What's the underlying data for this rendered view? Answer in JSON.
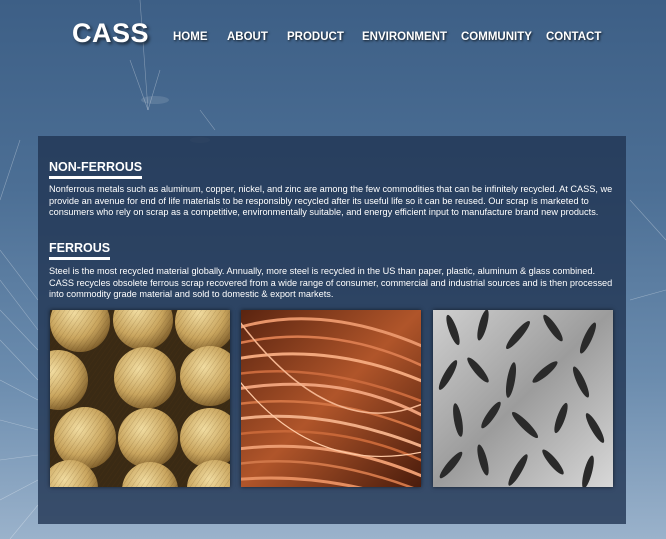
{
  "brand": {
    "logo": "CASS"
  },
  "nav": {
    "items": [
      {
        "label": "HOME"
      },
      {
        "label": "ABOUT"
      },
      {
        "label": "PRODUCT"
      },
      {
        "label": "ENVIRONMENT"
      },
      {
        "label": "COMMUNITY"
      },
      {
        "label": "CONTACT"
      }
    ]
  },
  "content": {
    "nonferrous": {
      "title": "NON-FERROUS",
      "text": "Nonferrous metals such as aluminum, copper, nickel, and zinc are among the few commodities that can be infinitely recycled. At CASS, we provide an avenue for end of life materials to be responsibly recycled after its useful life so it can be reused. Our scrap is marketed to consumers who rely on scrap as a competitive, environmentally suitable, and energy efficient input to manufacture brand new products."
    },
    "ferrous": {
      "title": "FERROUS",
      "text": "Steel is the most recycled material globally. Annually, more steel is recycled in the US than paper, plastic, aluminum & glass combined. CASS recycles obsolete ferrous scrap recovered from a wide range of consumer, commercial and industrial sources and is then processed into commodity grade material and sold to domestic & export markets."
    }
  },
  "photos": [
    {
      "icon": "brass-rods-photo"
    },
    {
      "icon": "copper-wire-photo"
    },
    {
      "icon": "steel-scrap-photo"
    }
  ],
  "colors": {
    "background_top": "#3d5f86",
    "background_bottom": "#9ab2cb",
    "panel": "#203452",
    "text": "#ffffff"
  }
}
